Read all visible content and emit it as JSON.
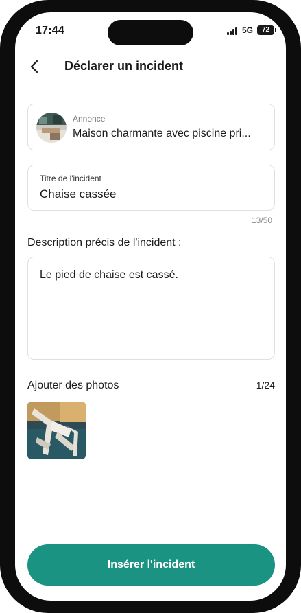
{
  "status_bar": {
    "time": "17:44",
    "network": "5G",
    "battery": "72"
  },
  "header": {
    "back_icon": "chevron-left-icon",
    "title": "Déclarer un incident"
  },
  "annonce": {
    "label": "Annonce",
    "value": "Maison charmante avec piscine pri..."
  },
  "incident_title": {
    "label": "Titre de l'incident",
    "value": "Chaise cassée",
    "char_count": "13/50"
  },
  "description": {
    "heading": "Description précis de l'incident :",
    "value": "Le pied de chaise est cassé."
  },
  "photos": {
    "heading": "Ajouter des photos",
    "count": "1/24"
  },
  "submit": {
    "label": "Insérer l'incident"
  },
  "colors": {
    "accent": "#1b9383",
    "border": "#e0e0e0",
    "frame": "#0d0d0d"
  }
}
